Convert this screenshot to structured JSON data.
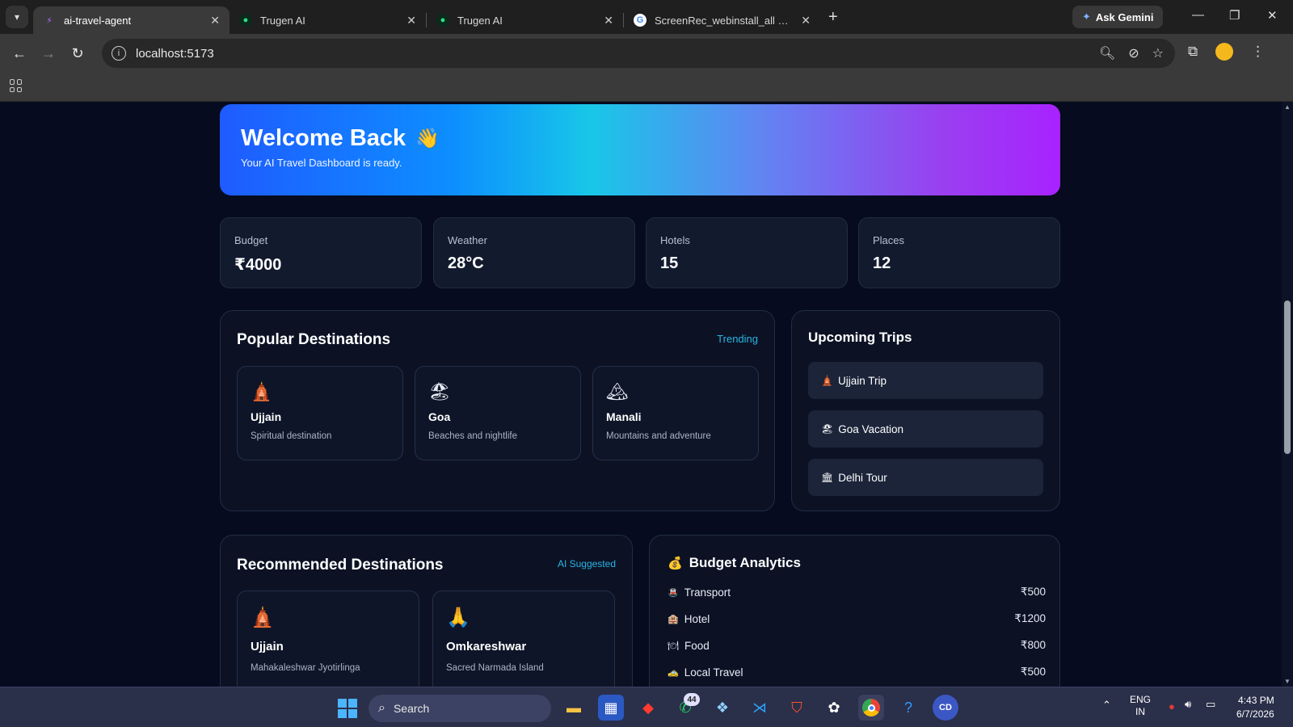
{
  "browser": {
    "tabs": [
      {
        "title": "ai-travel-agent",
        "active": true,
        "icon": "vite-icon"
      },
      {
        "title": "Trugen AI",
        "active": false,
        "icon": "trugen-icon"
      },
      {
        "title": "Trugen AI",
        "active": false,
        "icon": "trugen-icon"
      },
      {
        "title": "ScreenRec_webinstall_all how to",
        "active": false,
        "icon": "google-icon"
      }
    ],
    "ask_gemini": "Ask Gemini",
    "url": "localhost:5173"
  },
  "hero": {
    "title": "Welcome Back",
    "wave": "👋",
    "subtitle": "Your AI Travel Dashboard is ready."
  },
  "stats": [
    {
      "label": "Budget",
      "value": "₹4000"
    },
    {
      "label": "Weather",
      "value": "28°C"
    },
    {
      "label": "Hotels",
      "value": "15"
    },
    {
      "label": "Places",
      "value": "12"
    }
  ],
  "popular": {
    "title": "Popular Destinations",
    "tag": "Trending",
    "items": [
      {
        "emoji": "🛕",
        "name": "Ujjain",
        "desc": "Spiritual destination"
      },
      {
        "emoji": "🏖",
        "name": "Goa",
        "desc": "Beaches and nightlife"
      },
      {
        "emoji": "🏔",
        "name": "Manali",
        "desc": "Mountains and adventure"
      }
    ]
  },
  "upcoming": {
    "title": "Upcoming Trips",
    "items": [
      {
        "emoji": "🛕",
        "label": "Ujjain Trip"
      },
      {
        "emoji": "🏖",
        "label": "Goa Vacation"
      },
      {
        "emoji": "🏛",
        "label": "Delhi Tour"
      }
    ]
  },
  "recommended": {
    "title": "Recommended Destinations",
    "tag": "AI Suggested",
    "items": [
      {
        "emoji": "🛕",
        "name": "Ujjain",
        "desc": "Mahakaleshwar Jyotirlinga"
      },
      {
        "emoji": "🙏",
        "name": "Omkareshwar",
        "desc": "Sacred Narmada Island"
      }
    ]
  },
  "budget": {
    "title": "Budget Analytics",
    "emoji": "💰",
    "rows": [
      {
        "emoji": "🚇",
        "label": "Transport",
        "value": "₹500"
      },
      {
        "emoji": "🏨",
        "label": "Hotel",
        "value": "₹1200"
      },
      {
        "emoji": "🍽",
        "label": "Food",
        "value": "₹800"
      },
      {
        "emoji": "🚕",
        "label": "Local Travel",
        "value": "₹500"
      }
    ]
  },
  "taskbar": {
    "search": "Search",
    "whatsapp_badge": "44",
    "lang": "ENG",
    "region": "IN",
    "time": "4:43 PM",
    "date": "6/7/2026"
  },
  "colors": {
    "page_bg": "#060b1f",
    "card_bg": "#121a2e",
    "accent": "#27b6e6",
    "hero_gradient_start": "#1f5bff",
    "hero_gradient_end": "#a822ff"
  }
}
